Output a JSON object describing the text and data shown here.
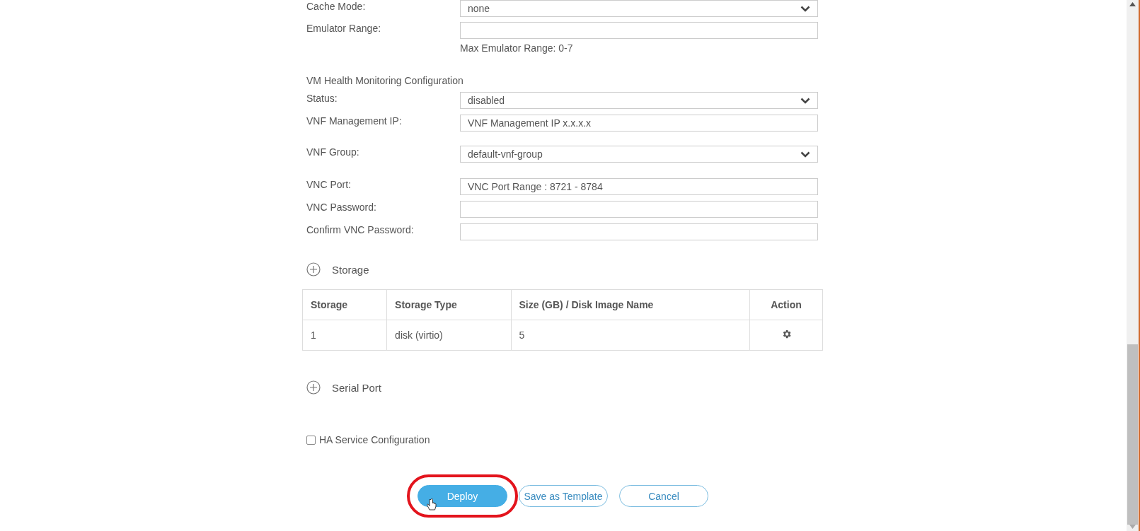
{
  "top_fields": [
    {
      "label": "Cache Mode:",
      "kind": "select",
      "value": "none"
    },
    {
      "label": "Emulator Range:",
      "kind": "input",
      "hint": "Max Emulator Range: 0-7"
    }
  ],
  "health": {
    "title": "VM Health Monitoring Configuration",
    "fields": [
      {
        "label": "Status:",
        "kind": "select",
        "value": "disabled"
      },
      {
        "label": "VNF Management IP:",
        "kind": "input",
        "placeholder": "VNF Management IP x.x.x.x"
      },
      {
        "label": "VNF Group:",
        "kind": "select",
        "value": "default-vnf-group"
      },
      {
        "label": "VNC Port:",
        "kind": "input",
        "placeholder": "VNC Port Range : 8721 - 8784"
      },
      {
        "label": "VNC Password:",
        "kind": "input"
      },
      {
        "label": "Confirm VNC Password:",
        "kind": "input"
      }
    ]
  },
  "storage": {
    "title": "Storage",
    "columns": [
      "Storage",
      "Storage Type",
      "Size (GB) / Disk Image Name",
      "Action"
    ],
    "rows": [
      {
        "cells": [
          "1",
          "disk (virtio)",
          "5"
        ]
      }
    ]
  },
  "serial_port": {
    "title": "Serial Port"
  },
  "ha_service": {
    "label": "HA Service Configuration",
    "checked": false
  },
  "buttons": [
    {
      "label": "Deploy",
      "kind": "primary",
      "highlighted": true
    },
    {
      "label": "Save as Template",
      "kind": "outline",
      "highlighted": false
    },
    {
      "label": "Cancel",
      "kind": "outline",
      "highlighted": false
    }
  ]
}
